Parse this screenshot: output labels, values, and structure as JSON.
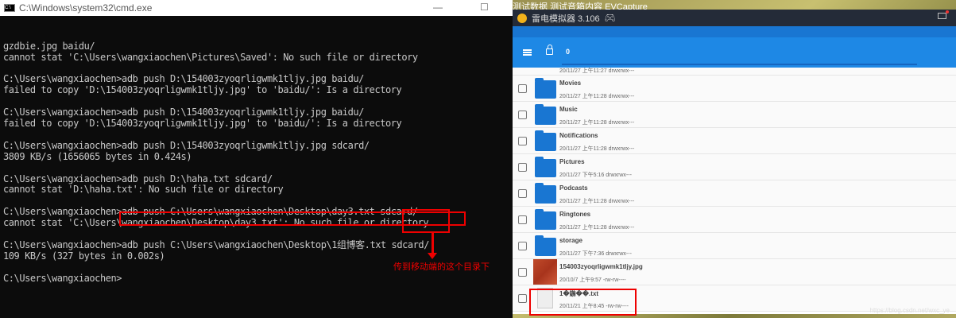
{
  "desktop": {
    "top_text": "测试数据     测试音箱内容                                  EVCapture"
  },
  "cmd": {
    "title": "C:\\Windows\\system32\\cmd.exe",
    "lines": [
      "gzdbie.jpg baidu/",
      "cannot stat 'C:\\Users\\wangxiaochen\\Pictures\\Saved': No such file or directory",
      "",
      "C:\\Users\\wangxiaochen>adb push D:\\154003zyoqrligwmk1tljy.jpg baidu/",
      "failed to copy 'D:\\154003zyoqrligwmk1tljy.jpg' to 'baidu/': Is a directory",
      "",
      "C:\\Users\\wangxiaochen>adb push D:\\154003zyoqrligwmk1tljy.jpg baidu/",
      "failed to copy 'D:\\154003zyoqrligwmk1tljy.jpg' to 'baidu/': Is a directory",
      "",
      "C:\\Users\\wangxiaochen>adb push D:\\154003zyoqrligwmk1tljy.jpg sdcard/",
      "3809 KB/s (1656065 bytes in 0.424s)",
      "",
      "C:\\Users\\wangxiaochen>adb push D:\\haha.txt sdcard/",
      "cannot stat 'D:\\haha.txt': No such file or directory",
      "",
      "C:\\Users\\wangxiaochen>adb push C:\\Users\\wangxiaochen\\Desktop\\day3.txt sdcard/",
      "cannot stat 'C:\\Users\\wangxiaochen\\Desktop\\day3.txt': No such file or directory",
      "",
      "C:\\Users\\wangxiaochen>adb push C:\\Users\\wangxiaochen\\Desktop\\1组博客.txt sdcard/",
      "109 KB/s (327 bytes in 0.002s)",
      "",
      "C:\\Users\\wangxiaochen>"
    ],
    "annotation": "传到移动端的这个目录下"
  },
  "emulator": {
    "title": "雷电模拟器 3.106",
    "path": "0",
    "top_row_meta": "20/11/27 上午11:27  drwxrwx---",
    "rows": [
      {
        "name": "Movies",
        "meta": "20/11/27 上午11:28  drwxrwx---",
        "type": "folder"
      },
      {
        "name": "Music",
        "meta": "20/11/27 上午11:28  drwxrwx---",
        "type": "folder"
      },
      {
        "name": "Notifications",
        "meta": "20/11/27 上午11:28  drwxrwx---",
        "type": "folder"
      },
      {
        "name": "Pictures",
        "meta": "20/11/27 下午5:16  drwxrwx---",
        "type": "folder"
      },
      {
        "name": "Podcasts",
        "meta": "20/11/27 上午11:28  drwxrwx---",
        "type": "folder"
      },
      {
        "name": "Ringtones",
        "meta": "20/11/27 上午11:28  drwxrwx---",
        "type": "folder"
      },
      {
        "name": "storage",
        "meta": "20/11/27 下午7:36  drwxrwx---",
        "type": "folder"
      },
      {
        "name": "154003zyoqrligwmk1tljy.jpg",
        "meta": "20/10/7 上午9:57  -rw-rw----",
        "type": "image"
      },
      {
        "name": "1�鍦��.txt",
        "meta": "20/11/21 上午8:45  -rw-rw----",
        "type": "text"
      }
    ],
    "folder_color": "#1976d2",
    "accent": "#1e88e5"
  },
  "watermark": "https://blog.csdn.net/wxc_ye"
}
